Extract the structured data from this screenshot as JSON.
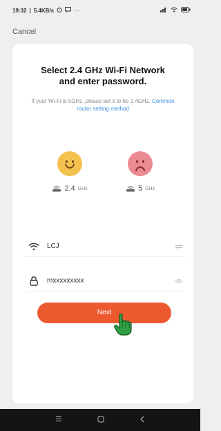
{
  "status_bar": {
    "time": "19:32",
    "speed": "5.4KB/s"
  },
  "header": {
    "cancel_label": "Cancel"
  },
  "card": {
    "title_line1": "Select 2.4 GHz Wi-Fi Network",
    "title_line2": "and enter password.",
    "subtitle_text": "If your Wi-Fi is 5GHz, please set it to be 2.4GHz.",
    "subtitle_link": "Common router setting method",
    "bands": [
      {
        "value": "2.4",
        "unit": "GHz",
        "status": "supported",
        "face_color": "#f3c24e"
      },
      {
        "value": "5",
        "unit": "GHz",
        "status": "unsupported",
        "face_color": "#ec8a92"
      }
    ],
    "wifi_field": {
      "value": "LCJ",
      "icon": "wifi-icon",
      "trailing_icon": "switch-network-icon"
    },
    "password_field": {
      "value": "mxxxxxxxxx",
      "icon": "lock-icon",
      "trailing_icon": "eye-icon"
    },
    "next_label": "Next",
    "accent_color": "#ee5a30"
  },
  "nav_bar": {
    "menu_icon": "menu-icon",
    "home_icon": "home-icon",
    "back_icon": "back-icon"
  }
}
